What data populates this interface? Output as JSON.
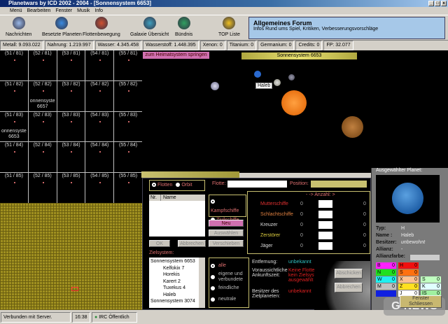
{
  "window": {
    "title": "Planetwars by ICD 2002 - 2004 - [Sonnensystem 6653]"
  },
  "menu": [
    "Menü",
    "Bearbeiten",
    "Fenster",
    "Musik",
    "Info"
  ],
  "toolbar": [
    {
      "label": "Nachrichten",
      "icon": "messages-icon",
      "color": "#9ab8e8"
    },
    {
      "label": "Besetzte Planeten",
      "icon": "planet-icon",
      "color": "#3a8ae0"
    },
    {
      "label": "Flottenbewegung",
      "icon": "rocket-icon",
      "color": "#d05030"
    },
    {
      "label": "Galaxie Übersicht",
      "icon": "galaxy-icon",
      "color": "#40a0c0"
    },
    {
      "label": "Bündnis",
      "icon": "alliance-icon",
      "color": "#30a060"
    },
    {
      "label": "TOP Liste",
      "icon": "smiley-icon",
      "color": "#f0c020"
    }
  ],
  "forum": {
    "title": "Allgemeines Forum",
    "subtitle": "Infos Rund ums Spiel, Kritiken, Verbesserungsvorschläge"
  },
  "resources": [
    "Metall: 9.093.022",
    "Nahrung: 1.219.997",
    "Wasser: 4.345.458",
    "Wasserstoff: 1.448.395",
    "Xenon: 0",
    "Titanium: 0",
    "Germanium: 0",
    "Credits: 0",
    "FP: 32.077"
  ],
  "grid": [
    {
      "label": "(51 / 81)"
    },
    {
      "label": "(52 / 81)"
    },
    {
      "label": "(53 / 81)"
    },
    {
      "label": "(54 / 81)"
    },
    {
      "label": "(55 / 81)"
    },
    {
      "label": "(51 / 82)"
    },
    {
      "label": "(52 / 82)",
      "system": "onnensyste 6657"
    },
    {
      "label": "(53 / 82)"
    },
    {
      "label": "(54 / 82)"
    },
    {
      "label": "(55 / 82)"
    },
    {
      "label": "(51 / 83)",
      "system": "onnensyste 6653"
    },
    {
      "label": "(52 / 83)"
    },
    {
      "label": "(53 / 83)"
    },
    {
      "label": "(54 / 83)"
    },
    {
      "label": "(55 / 83)"
    },
    {
      "label": "(51 / 84)"
    },
    {
      "label": "(52 / 84)"
    },
    {
      "label": "(53 / 84)"
    },
    {
      "label": "(54 / 84)"
    },
    {
      "label": "(55 / 84)"
    },
    {
      "label": "(51 / 85)"
    },
    {
      "label": "(52 / 85)"
    },
    {
      "label": "(53 / 85)"
    },
    {
      "label": "(54 / 85)"
    },
    {
      "label": "(55 / 85)"
    }
  ],
  "space": {
    "home_button": "zum Heimatsystem springen",
    "system_name": "Sonnensystem 6653",
    "planet_tooltip": "Haleb"
  },
  "fleet": {
    "radio_fleets": "Flotten",
    "radio_orbit": "Orbit",
    "fleet_label": "Flotte:",
    "position_label": "Position:",
    "list_headers": [
      "Nr.",
      "Name"
    ],
    "radio_combat": "Kampfschiffe",
    "radio_civil": "Zivilschiffe",
    "btn_new": "Neu",
    "btn_select": "Auswählen",
    "btn_move": "Verschieben",
    "btn_ok": "OK",
    "btn_cancel": "Abbrechen",
    "count_header": "- -> Anzahl: >",
    "ships": [
      {
        "name": "Mutterschiffe",
        "have": "0",
        "max": "0",
        "color": "#e03030"
      },
      {
        "name": "Schlachtschiffe",
        "have": "0",
        "max": "0",
        "color": "#e08040"
      },
      {
        "name": "Kreuzer",
        "have": "0",
        "max": "0",
        "color": "#dddddd"
      },
      {
        "name": "Zerstörer",
        "have": "0",
        "max": "0",
        "color": "#e0d040"
      },
      {
        "name": "Jäger",
        "have": "0",
        "max": "0",
        "color": "#dddddd"
      }
    ],
    "target_label": "Zielsystem:",
    "tree": [
      "Sonnensystem 6653",
      "Kelfokix 7",
      "Horekis",
      "Karert 2",
      "Tuxekus 4",
      "Haleb",
      "Sonnensystem 3074"
    ],
    "filters": [
      "alle",
      "eigene und verbundete",
      "feindliche",
      "neutrale"
    ],
    "distance_label": "Entfernung:",
    "distance_value": "unbekannt",
    "arrival_label": "Voraussichtliche Ankunftszeit:",
    "arrival_value": "Keine Flotte und kein Zielsystem ausgewählt",
    "owner_label": "Besitzer des Zielplaneten:",
    "owner_value": "unbekannt",
    "btn_send": "Abschicken",
    "btn_abort": "Abbrechen"
  },
  "planet": {
    "title": "Ausgewählter Planet:",
    "type_label": "Typ:",
    "type": "H",
    "name_label": "Name :",
    "name": "Haleb",
    "owner_label": "Besitzer:",
    "owner": "unbewohnt",
    "alliance_label": "Allianz:",
    "alliance": "-",
    "alliance_color_label": "Allianzfarbe:",
    "legend": [
      {
        "k": "B",
        "v": "0",
        "color": "#ff20ff"
      },
      {
        "k": "N",
        "v": "0",
        "color": "#20e020"
      },
      {
        "k": "W",
        "v": "0",
        "color": "#20f0f0"
      },
      {
        "k": "M",
        "v": "0",
        "color": "#c0c0c0"
      },
      {
        "k": "",
        "v": "",
        "color": "#1020e0"
      },
      {
        "k": "H",
        "v": "0",
        "color": "#f01010"
      },
      {
        "k": "S",
        "v": "0",
        "color": "#ff7010"
      },
      {
        "k": "X",
        "v": "0",
        "color": "#ffc090"
      },
      {
        "k": "Z",
        "v": "0",
        "color": "#ffe020"
      },
      {
        "k": "J",
        "v": "0",
        "color": "#ffffff"
      },
      {
        "k": "S",
        "v": "0",
        "color": "#c0ffc0"
      },
      {
        "k": "K",
        "v": "0",
        "color": "#e0ffff"
      },
      {
        "k": "IS",
        "v": "0",
        "color": "#a0f0a0"
      }
    ],
    "close_button": "Fenster Schliessen"
  },
  "status": {
    "connection": "Verbunden mit Server.",
    "time": "16:38",
    "irc": "IRC Öffentlich"
  },
  "watermark": "G-NEWS"
}
